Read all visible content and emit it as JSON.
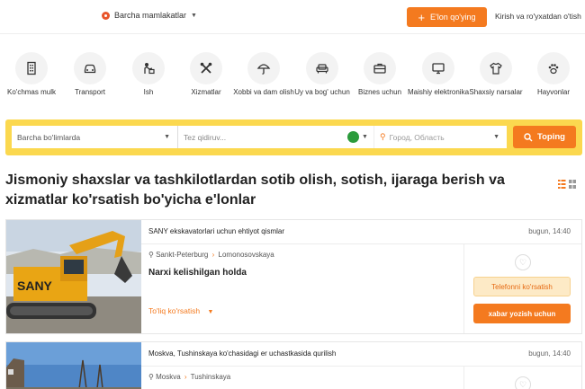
{
  "header": {
    "country": "Barcha mamlakatlar",
    "post_button": "E'lon qo'ying",
    "login": "Kirish va ro'yxatdan o'tish"
  },
  "categories": [
    {
      "label": "Ko'chmas mulk",
      "icon": "building-icon"
    },
    {
      "label": "Transport",
      "icon": "car-icon"
    },
    {
      "label": "Ish",
      "icon": "worker-icon"
    },
    {
      "label": "Xizmatlar",
      "icon": "tools-icon"
    },
    {
      "label": "Xobbi va dam olish",
      "icon": "umbrella-icon"
    },
    {
      "label": "Uy va bog' uchun",
      "icon": "sofa-icon"
    },
    {
      "label": "Biznes uchun",
      "icon": "briefcase-icon"
    },
    {
      "label": "Maishiy elektronika",
      "icon": "monitor-icon"
    },
    {
      "label": "Shaxsiy narsalar",
      "icon": "shirt-icon"
    },
    {
      "label": "Hayvonlar",
      "icon": "paw-icon"
    }
  ],
  "search": {
    "category": "Barcha bo'limlarda",
    "query_placeholder": "Tez qidiruv...",
    "city_placeholder": "Город, Область",
    "button": "Toping"
  },
  "page_title": "Jismoniy shaxslar va tashkilotlardan sotib olish, sotish, ijaraga berish va xizmatlar ko'rsatish bo'yicha e'lonlar",
  "listings": [
    {
      "title": "SANY ekskavatorlari uchun ehtiyot qismlar",
      "date": "bugun, 14:40",
      "city": "Sankt-Peterburg",
      "district": "Lomonosovskaya",
      "price": "Narxi kelishilgan holda",
      "more": "To'liq ko'rsatish",
      "phone_button": "Telefonni ko'rsatish",
      "message_button": "xabar yozish uchun"
    },
    {
      "title": "Moskva, Tushinskaya ko'chasidagi er uchastkasida qurilish",
      "date": "bugun, 14:40",
      "city": "Moskva",
      "district": "Tushinskaya"
    }
  ],
  "colors": {
    "accent": "#f47a1f",
    "search_bg": "#fbd84f",
    "phone_bg": "#fdeac6"
  }
}
